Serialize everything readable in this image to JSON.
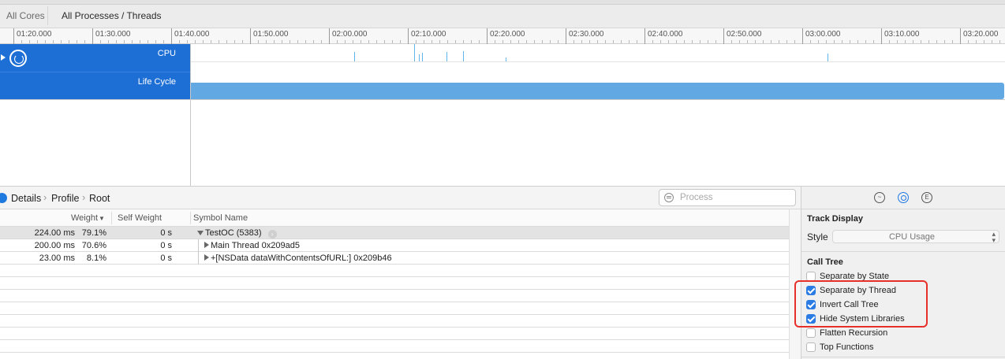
{
  "filter_bar": {
    "tabs": [
      {
        "label": "All Cores"
      },
      {
        "label": "All Processes / Threads"
      }
    ]
  },
  "ruler": {
    "ticks": [
      "01:20.000",
      "01:30.000",
      "01:40.000",
      "01:50.000",
      "02:00.000",
      "02:10.000",
      "02:20.000",
      "02:30.000",
      "02:40.000",
      "02:50.000",
      "03:00.000",
      "03:10.000",
      "03:20.000"
    ]
  },
  "tracks": {
    "cpu_label": "CPU",
    "lifecycle_label": "Life Cycle",
    "cpu_icon": "gauge-icon",
    "accent_color": "#1d6fd6",
    "lifecycle_bar_color": "#62a8e3",
    "cpu_spike_color": "#5fb5ec"
  },
  "breadcrumb": {
    "items": [
      "Details",
      "Profile",
      "Root"
    ]
  },
  "search": {
    "placeholder": "Process",
    "value": ""
  },
  "table": {
    "headers": {
      "weight": "Weight",
      "self_weight": "Self Weight",
      "symbol_name": "Symbol Name"
    },
    "rows": [
      {
        "weight": "224.00 ms",
        "percent": "79.1%",
        "self_weight": "0 s",
        "symbol": "TestOC (5383)",
        "expanded": true
      },
      {
        "weight": "200.00 ms",
        "percent": "70.6%",
        "self_weight": "0 s",
        "symbol": "Main Thread  0x209ad5",
        "expanded": false
      },
      {
        "weight": "23.00 ms",
        "percent": "8.1%",
        "self_weight": "0 s",
        "symbol": "+[NSData dataWithContentsOfURL:]  0x209b46",
        "expanded": false
      }
    ]
  },
  "inspector": {
    "tab_icons": [
      "waveform-icon",
      "gear-icon",
      "extended-info-icon"
    ],
    "extended_glyph": "E",
    "track_display_title": "Track Display",
    "style_label": "Style",
    "style_value": "CPU Usage",
    "call_tree_title": "Call Tree",
    "options": [
      {
        "label": "Separate by State",
        "checked": false
      },
      {
        "label": "Separate by Thread",
        "checked": true
      },
      {
        "label": "Invert Call Tree",
        "checked": true
      },
      {
        "label": "Hide System Libraries",
        "checked": true
      },
      {
        "label": "Flatten Recursion",
        "checked": false
      },
      {
        "label": "Top Functions",
        "checked": false
      }
    ],
    "highlight_color": "#e8302a"
  }
}
